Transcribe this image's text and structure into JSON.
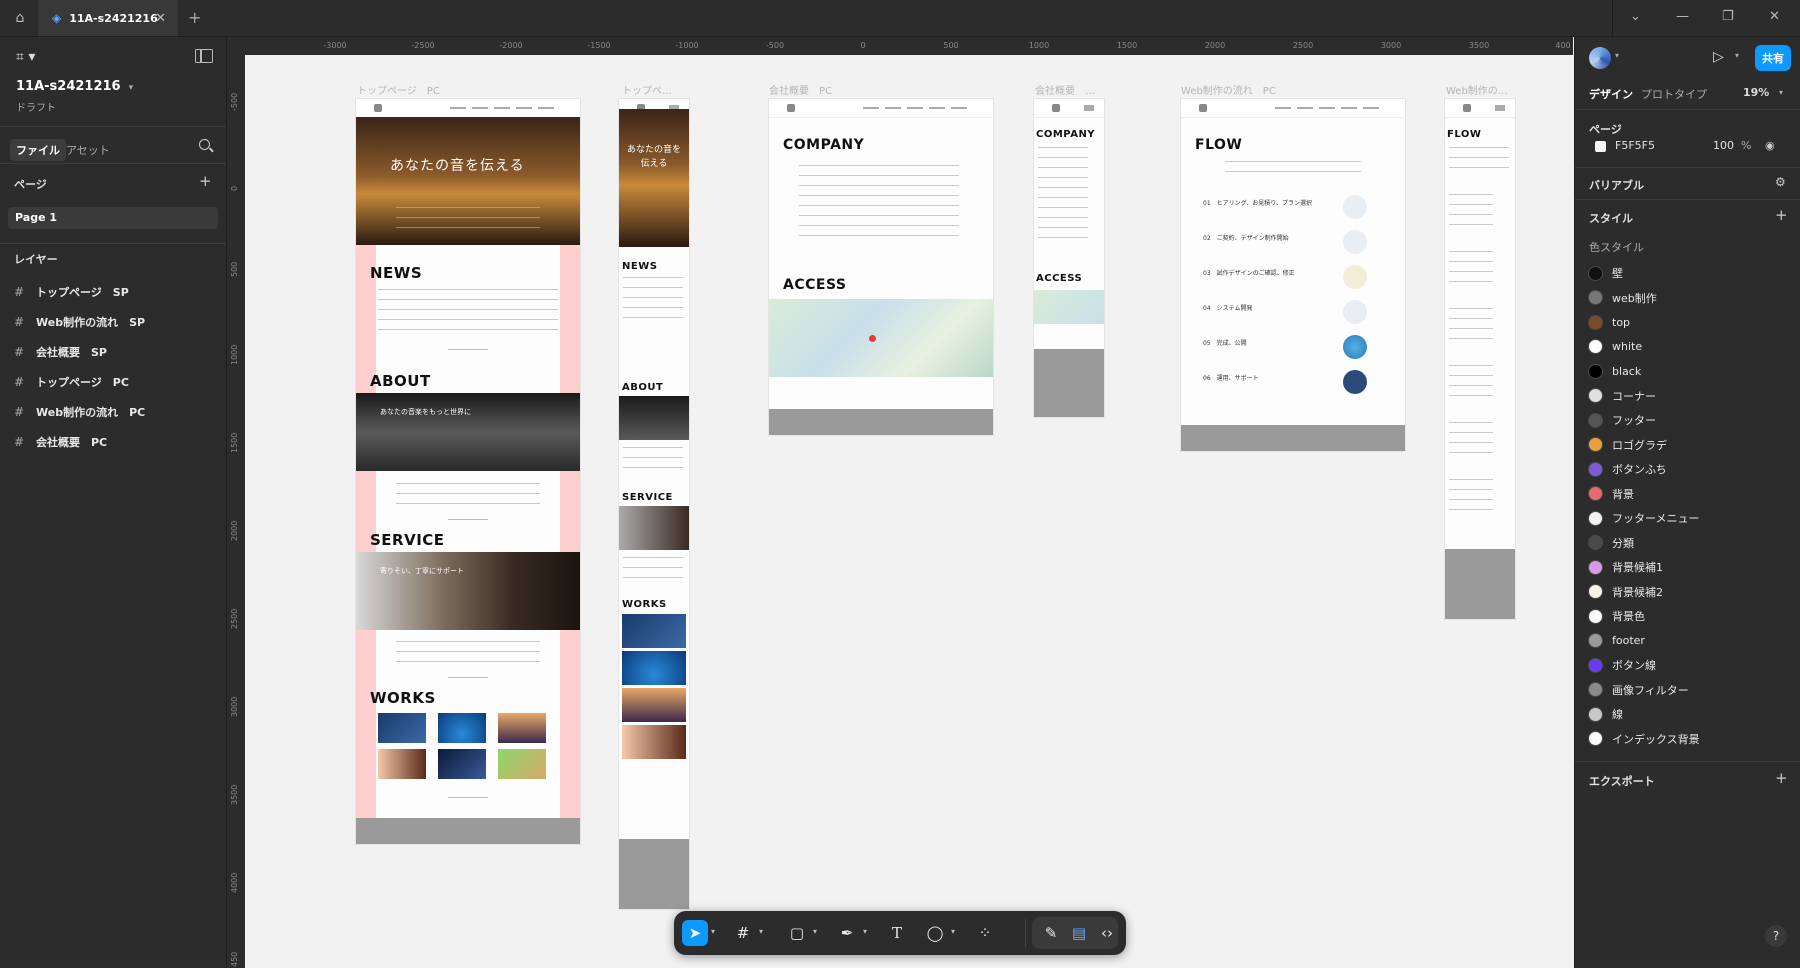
{
  "titlebar": {
    "tab_title": "11A-s2421216",
    "close_glyph": "✕",
    "add_glyph": "+",
    "window_controls": [
      "⌄",
      "—",
      "❐",
      "✕"
    ]
  },
  "left_panel": {
    "file_title": "11A-s2421216",
    "file_subtitle": "ドラフト",
    "tabs": [
      "ファイル",
      "アセット"
    ],
    "pages_header": "ページ",
    "pages": [
      "Page 1"
    ],
    "layers_header": "レイヤー",
    "layers": [
      "トップページ　SP",
      "Web制作の流れ　SP",
      "会社概要　SP",
      "トップページ　PC",
      "Web制作の流れ　PC",
      "会社概要　PC"
    ]
  },
  "ruler": {
    "top": [
      "-3000",
      "-2500",
      "-2000",
      "-1500",
      "-1000",
      "-500",
      "0",
      "500",
      "1000",
      "1500",
      "2000",
      "2500",
      "3000",
      "3500",
      "400"
    ],
    "left": [
      "-500",
      "0",
      "500",
      "1000",
      "1500",
      "2000",
      "2500",
      "3000",
      "3500",
      "4000",
      "450"
    ]
  },
  "canvas": {
    "frame_labels": [
      "トップページ　PC",
      "トップペ…",
      "会社概要　PC",
      "会社概要　…",
      "Web制作の流れ　PC",
      "Web制作の…"
    ],
    "top_pc": {
      "hero_text": "あなたの音を伝える",
      "headings": [
        "NEWS",
        "ABOUT",
        "SERVICE",
        "WORKS"
      ],
      "about_caption": "あなたの音楽をもっと世界に",
      "service_caption": "寄りそい、丁寧にサポート"
    },
    "top_sp": {
      "hero_text": "あなたの音を伝える",
      "headings": [
        "NEWS",
        "ABOUT",
        "SERVICE",
        "WORKS"
      ]
    },
    "company_pc": {
      "headings": [
        "COMPANY",
        "ACCESS"
      ]
    },
    "company_sp": {
      "headings": [
        "COMPANY",
        "ACCESS"
      ]
    },
    "flow_pc": {
      "heading": "FLOW",
      "steps": [
        "01　ヒアリング、お見積り、プラン選択",
        "02　ご契約、デザイン制作開始",
        "03　試作デザインのご確認、修正",
        "04　システム開発",
        "05　完成、公開",
        "06　運用、サポート"
      ]
    },
    "flow_sp": {
      "heading": "FLOW"
    }
  },
  "toolbar": {
    "tools": [
      "move-tool",
      "frame-tool",
      "rectangle-tool",
      "pen-tool",
      "text-tool",
      "comment-tool",
      "components-tool",
      "draw-tool",
      "dev-mode-tool",
      "code-tool"
    ],
    "text_glyph": "T"
  },
  "right_panel": {
    "share_label": "共有",
    "tabs": [
      "デザイン",
      "プロトタイプ"
    ],
    "zoom": "19%",
    "page_section": "ページ",
    "page_bg_hex": "F5F5F5",
    "page_bg_opacity": "100",
    "percent_sign": "%",
    "variables_label": "バリアブル",
    "styles_label": "スタイル",
    "color_styles_label": "色スタイル",
    "color_styles": [
      {
        "name": "壁",
        "color": "#111111"
      },
      {
        "name": "web制作",
        "color": "#777777"
      },
      {
        "name": "top",
        "color": "#7a4a2a"
      },
      {
        "name": "white",
        "color": "#ffffff"
      },
      {
        "name": "black",
        "color": "#000000"
      },
      {
        "name": "コーナー",
        "color": "#e0e0e0"
      },
      {
        "name": "フッター",
        "color": "#555555"
      },
      {
        "name": "ロゴグラデ",
        "color": "#e8a23c"
      },
      {
        "name": "ボタンふち",
        "color": "#7c5bd6"
      },
      {
        "name": "背景",
        "color": "#e86a6a"
      },
      {
        "name": "フッターメニュー",
        "color": "#f2f2f2"
      },
      {
        "name": "分類",
        "color": "#4a4a4a"
      },
      {
        "name": "背景候補1",
        "color": "#d89ae8"
      },
      {
        "name": "背景候補2",
        "color": "#f7f2e8"
      },
      {
        "name": "背景色",
        "color": "#fafafa"
      },
      {
        "name": "footer",
        "color": "#9a9a9a"
      },
      {
        "name": "ボタン線",
        "color": "#6a3cf0"
      },
      {
        "name": "画像フィルター",
        "color": "#8a8a8a"
      },
      {
        "name": "線",
        "color": "#c8c8c8"
      },
      {
        "name": "インデックス背景",
        "color": "#fafafa"
      }
    ],
    "export_label": "エクスポート",
    "help_glyph": "?"
  }
}
